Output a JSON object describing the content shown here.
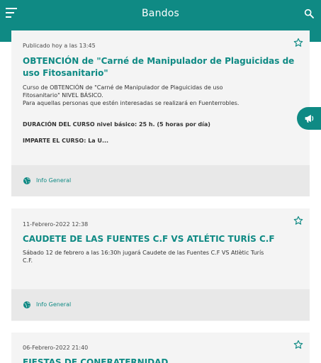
{
  "appbar": {
    "title": "Bandos",
    "menu_icon": "menu-icon",
    "search_icon": "search-icon"
  },
  "colors": {
    "primary": "#0f8a84",
    "card_bg": "#f4f4f4",
    "footer_bg": "#e8e8e8"
  },
  "cards": [
    {
      "date": "Publicado hoy a las 13:45",
      "title": "OBTENCIÓN de \"Carné de Manipulador de Plaguicidas de uso Fitosanitario\"",
      "body_line1": "Curso de OBTENCIÓN de \"Carné de Manipulador de Plaguicidas de uso",
      "body_line2": "Fitosanitario\" NIVEL BÁSICO.",
      "body_line3": "Para aquellas personas que estén interesadas se realizará en Fuenterrobles.",
      "body_line4": "DURACIÓN DEL CURSO nivel básico: 25 h. (5 horas por día)",
      "body_line5": "IMPARTE EL CURSO: La U...",
      "category": "Info General"
    },
    {
      "date": "11-Febrero-2022 12:38",
      "title": "CAUDETE DE LAS FUENTES C.F VS ATLÉTIC TURÍS C.F",
      "body_line1": "Sábado 12 de febrero a las 16:30h jugará Caudete de las Fuentes C.F VS Atlètic Turís",
      "body_line2": "C.F.",
      "category": "Info General"
    },
    {
      "date": "06-Febrero-2022 21:40",
      "title": "FIESTAS DE CONFRATERNIDAD"
    }
  ]
}
